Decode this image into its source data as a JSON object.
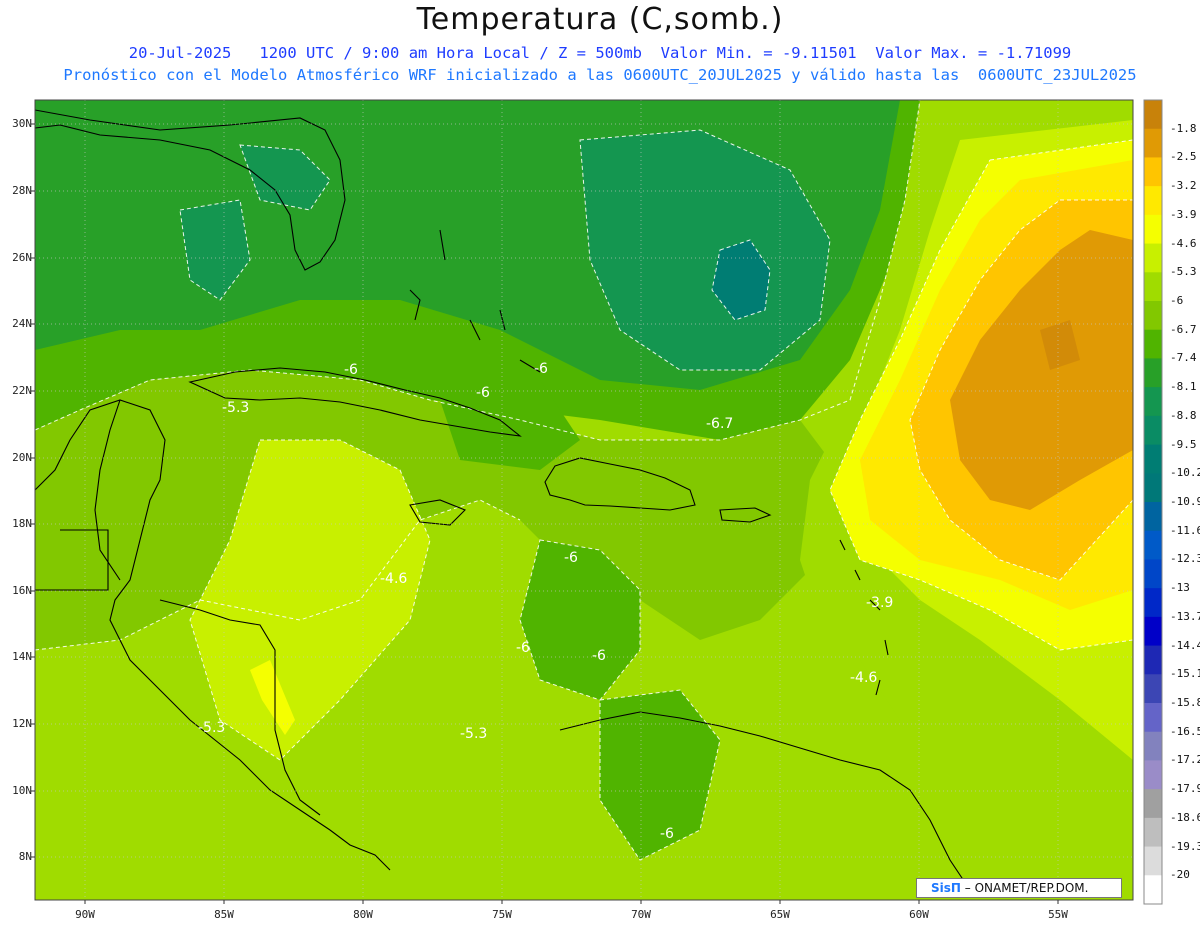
{
  "header": {
    "title": "Temperatura (C,somb.)",
    "line1": "20-Jul-2025   1200 UTC / 9:00 am Hora Local / Z = 500mb  Valor Min. = -9.11501  Valor Max. = -1.71099",
    "line2": "Pronóstico con el Modelo Atmosférico WRF inicializado a las 0600UTC_20JUL2025 y válido hasta las  0600UTC_23JUL2025"
  },
  "axes": {
    "lat_labels": [
      "30N",
      "28N",
      "26N",
      "24N",
      "22N",
      "20N",
      "18N",
      "16N",
      "14N",
      "12N",
      "10N",
      "8N"
    ],
    "lon_labels": [
      "90W",
      "85W",
      "80W",
      "75W",
      "70W",
      "65W",
      "60W",
      "55W"
    ]
  },
  "colorbar": {
    "labels": [
      "-1.8",
      "-2.5",
      "-3.2",
      "-3.9",
      "-4.6",
      "-5.3",
      "-6",
      "-6.7",
      "-7.4",
      "-8.1",
      "-8.8",
      "-9.5",
      "-10.2",
      "-10.9",
      "-11.6",
      "-12.3",
      "-13",
      "-13.7",
      "-14.4",
      "-15.1",
      "-15.8",
      "-16.5",
      "-17.2",
      "-17.9",
      "-18.6",
      "-19.3",
      "-20"
    ],
    "colors": [
      "#c8820a",
      "#e09a05",
      "#ffc500",
      "#ffe900",
      "#f5ff00",
      "#c8f000",
      "#a0dc00",
      "#82c800",
      "#50b400",
      "#28a028",
      "#149650",
      "#0a8c64",
      "#007d73",
      "#007878",
      "#0064a0",
      "#005ac8",
      "#0046c8",
      "#0028c8",
      "#0000c8",
      "#1e28b4",
      "#3c46b4",
      "#6464c8",
      "#8282be",
      "#9a8cc8",
      "#a0a0a0",
      "#bebebe",
      "#dcdcdc",
      "#ffffff"
    ]
  },
  "contour_labels": [
    "-6",
    "-6",
    "-6",
    "-5.3",
    "-6.7",
    "-4.6",
    "-6",
    "-6",
    "-3.9",
    "-4.6",
    "-5.3",
    "-5.3",
    "-6",
    "-6"
  ],
  "credit": {
    "brand": "SisΠ",
    "text": " – ONAMET/REP.DOM."
  }
}
